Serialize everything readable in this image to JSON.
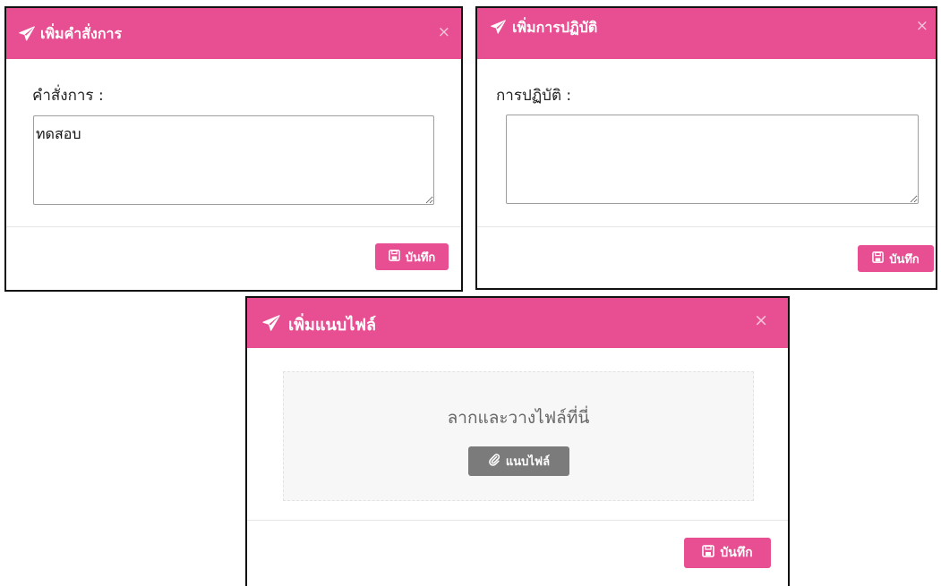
{
  "colors": {
    "accent": "#e84f92",
    "attach_button": "#7b7b7b",
    "dropzone_bg": "#f7f7f7"
  },
  "modals": [
    {
      "title": "เพิ่มคำสั่งการ",
      "header_icon": "send-icon",
      "close_label": "×",
      "field_label": "คำสั่งการ :",
      "field_value": "ทดสอบ",
      "save_label": "บันทึก",
      "save_icon": "save-icon"
    },
    {
      "title": "เพิ่มการปฏิบัติ",
      "header_icon": "send-icon",
      "close_label": "×",
      "field_label": "การปฏิบัติ :",
      "field_value": "",
      "save_label": "บันทึก",
      "save_icon": "save-icon"
    },
    {
      "title": "เพิ่มแนบไฟล์",
      "header_icon": "send-icon",
      "close_label": "×",
      "dropzone_text": "ลากและวางไฟล์ที่นี่",
      "attach_label": "แนบไฟล์",
      "attach_icon": "paperclip-icon",
      "save_label": "บันทึก",
      "save_icon": "save-icon"
    }
  ]
}
